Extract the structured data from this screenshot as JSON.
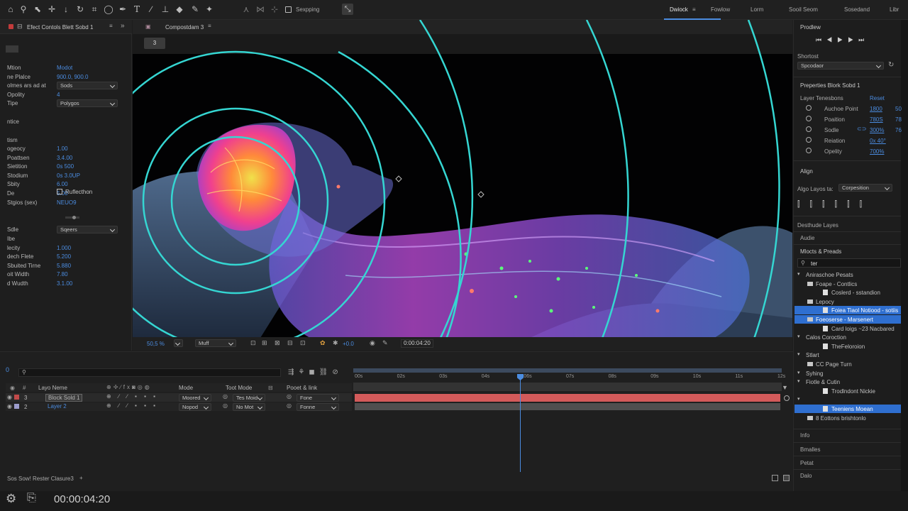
{
  "toolbar": {
    "toggle_label": "Sexpping",
    "workspaces": [
      "Dwiock",
      "Fowlow",
      "Lorm",
      "Sooil Seom",
      "Sosedand",
      "Libr"
    ],
    "active_workspace": "Dwiock"
  },
  "effect_controls": {
    "tab_title": "Efect Contols Blett Sobd 1",
    "rows": [
      {
        "label": "Mtion",
        "value": "Modot"
      },
      {
        "label": "ne Plalce",
        "value": "900.0, 900.0"
      },
      {
        "label": "olmes ars ad at",
        "value": "Sods",
        "dropdown": true
      },
      {
        "label": "Opolity",
        "value": "4"
      },
      {
        "label": "Tipe",
        "value": "Polygos",
        "dropdown": true
      },
      {
        "label": "ntice",
        "value": ""
      },
      {
        "label": "tism",
        "value": ""
      },
      {
        "label": "ogeocy",
        "value": "1.00"
      },
      {
        "label": "Poattsen",
        "value": "3.4.00"
      },
      {
        "label": "Sietition",
        "value": "0s 500"
      },
      {
        "label": "Stodium",
        "value": "0s 3.0UP"
      },
      {
        "label": "Sbity",
        "value": "6.00"
      },
      {
        "label": "De",
        "value": "5.00"
      },
      {
        "label": "Stgios (sex)",
        "value": "NEUO9"
      }
    ],
    "reflection_label": "Ruflecthon",
    "rows2": [
      {
        "label": "Sdle",
        "value": "Sqeers",
        "dropdown": true
      },
      {
        "label": "Ibe",
        "value": ""
      },
      {
        "label": "lecity",
        "value": "1.000"
      },
      {
        "label": "dech Flete",
        "value": "5.200"
      },
      {
        "label": "Sbuited Tirne",
        "value": "5.880"
      },
      {
        "label": "oit Width",
        "value": "7.80"
      },
      {
        "label": "d Wudth",
        "value": "3.1.00"
      }
    ]
  },
  "composition": {
    "tab_title": "Compostdam 3",
    "subtab": "3",
    "zoom": "50,5 %",
    "resolution": "Muff",
    "exposure": "+0.0",
    "timecode_small": "0:00:04:20"
  },
  "preview": {
    "title": "Prodlew",
    "shortcut_label": "Shortost",
    "shortcut_value": "Spcodaor"
  },
  "properties": {
    "title": "Preperties Blork Sobd 1",
    "layer_transform": "Layer Tenesbons",
    "reset": "Reset",
    "items": [
      {
        "label": "Auchoe Point",
        "value": "1800",
        "extra": "50"
      },
      {
        "label": "Poaition",
        "value": "780S",
        "extra": "78"
      },
      {
        "label": "Sodle",
        "value": "300%",
        "extra": "76"
      },
      {
        "label": "Reiation",
        "value": "0x 40°",
        "extra": ""
      },
      {
        "label": "Opelity",
        "value": "700%",
        "extra": ""
      }
    ]
  },
  "align": {
    "title": "Align",
    "align_to_label": "Algo Layos ta:",
    "align_to_value": "Corpesition",
    "distribute": "Desthude Layes"
  },
  "audio": {
    "title": "Audie"
  },
  "effects_presets": {
    "title": "Mlocts & Preads",
    "search": "ter",
    "tree": [
      {
        "text": "Aniraschoe Pesats",
        "level": 0,
        "selected": false
      },
      {
        "text": "Foape - Contlics",
        "level": 1,
        "selected": false
      },
      {
        "text": "Coslerd - sstandion",
        "level": 2,
        "selected": false
      },
      {
        "text": "Lepocy",
        "level": 1,
        "selected": false
      },
      {
        "text": "Foiea Tiaol Notiood - sotiis",
        "level": 2,
        "selected": true
      },
      {
        "text": "Foeoserse - Marsenert",
        "level": 1,
        "selected": true
      },
      {
        "text": "Card loigs ~23 Nacbared",
        "level": 2,
        "selected": false
      },
      {
        "text": "Calos Coroction",
        "level": 0,
        "selected": false
      },
      {
        "text": "TheFeloroion",
        "level": 2,
        "selected": false
      },
      {
        "text": "Stlart",
        "level": 0,
        "selected": false
      },
      {
        "text": "CC Page Turn",
        "level": 1,
        "selected": false
      },
      {
        "text": "Syhing",
        "level": 0,
        "selected": false
      },
      {
        "text": "Fiotle & Cutin",
        "level": 0,
        "selected": false
      },
      {
        "text": "Trodlndont Nickie",
        "level": 2,
        "selected": false
      },
      {
        "text": "",
        "level": 0,
        "selected": false
      },
      {
        "text": "Teeniens Moean",
        "level": 2,
        "selected": true
      },
      {
        "text": "8 Eottons brishtonlo",
        "level": 1,
        "selected": false
      }
    ]
  },
  "bottom_panels": [
    "Info",
    "Bmalles",
    "Petat",
    "Dalo"
  ],
  "timeline": {
    "columns": {
      "name": "Layo Neme",
      "mode": "Mode",
      "track": "Toot Mode",
      "parent": "Pooet & Iink"
    },
    "layers": [
      {
        "num": "3",
        "name": "Block Sold 1",
        "mode": "Moored",
        "track": "Tes Moid",
        "parent": "Fone",
        "color": "#c14949"
      },
      {
        "num": "2",
        "name": "Layer 2",
        "mode": "Nopod",
        "track": "No Mot",
        "parent": "Fonne",
        "color": "#9c9ccc"
      }
    ],
    "ticks": [
      "00s",
      "02s",
      "03s",
      "04s",
      "06s",
      "07s",
      "08s",
      "09s",
      "10s",
      "11s",
      "12s"
    ],
    "footer_label": "Sos Sow! Rester Clasure3",
    "timecode": "00:00:04:20"
  }
}
